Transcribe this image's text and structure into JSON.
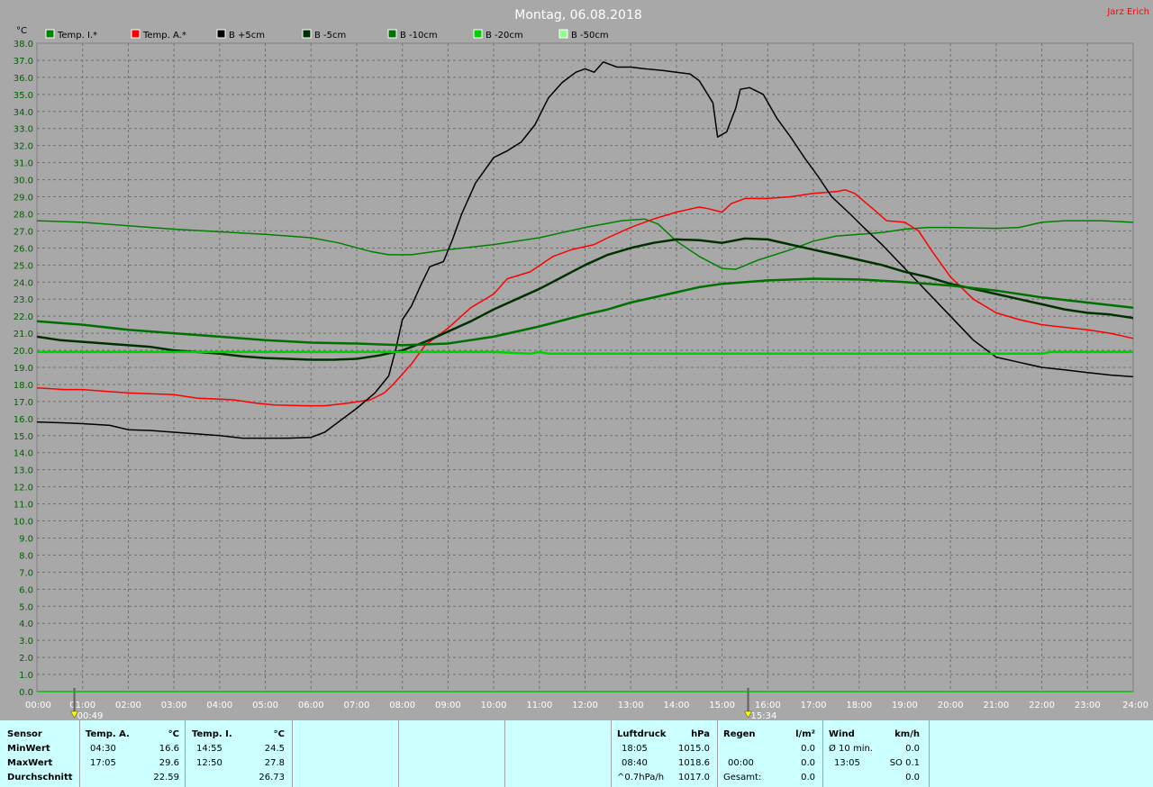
{
  "header": {
    "title": "Montag, 06.08.2018",
    "author": "Jarz Erich"
  },
  "chart_data": {
    "type": "line",
    "title": "Montag, 06.08.2018",
    "ylabel": "°C",
    "ylim": [
      0,
      38
    ],
    "xlim": [
      0,
      24
    ],
    "grid": true,
    "legend_position": "top",
    "x_tick_labels": [
      "00:00",
      "01:00",
      "02:00",
      "03:00",
      "04:00",
      "05:00",
      "06:00",
      "07:00",
      "08:00",
      "09:00",
      "10:00",
      "11:00",
      "12:00",
      "13:00",
      "14:00",
      "15:00",
      "16:00",
      "17:00",
      "18:00",
      "19:00",
      "20:00",
      "21:00",
      "22:00",
      "23:00",
      "24:00"
    ],
    "y_tick_labels": [
      "0.0",
      "1.0",
      "2.0",
      "3.0",
      "4.0",
      "5.0",
      "6.0",
      "7.0",
      "8.0",
      "9.0",
      "10.0",
      "11.0",
      "12.0",
      "13.0",
      "14.0",
      "15.0",
      "16.0",
      "17.0",
      "18.0",
      "19.0",
      "20.0",
      "21.0",
      "22.0",
      "23.0",
      "24.0",
      "25.0",
      "26.0",
      "27.0",
      "28.0",
      "29.0",
      "30.0",
      "31.0",
      "32.0",
      "33.0",
      "34.0",
      "35.0",
      "36.0",
      "37.0",
      "38.0"
    ],
    "series": [
      {
        "name": "Temp. I.*",
        "color": "#008000",
        "width": 1.5,
        "points": [
          [
            0,
            27.6
          ],
          [
            1,
            27.5
          ],
          [
            2,
            27.3
          ],
          [
            3,
            27.1
          ],
          [
            4,
            26.95
          ],
          [
            5,
            26.8
          ],
          [
            6,
            26.6
          ],
          [
            6.6,
            26.3
          ],
          [
            7.3,
            25.8
          ],
          [
            7.7,
            25.6
          ],
          [
            8.2,
            25.6
          ],
          [
            9,
            25.9
          ],
          [
            10,
            26.2
          ],
          [
            11,
            26.6
          ],
          [
            12,
            27.2
          ],
          [
            12.8,
            27.6
          ],
          [
            13.3,
            27.7
          ],
          [
            13.6,
            27.4
          ],
          [
            14,
            26.4
          ],
          [
            14.5,
            25.5
          ],
          [
            15,
            24.8
          ],
          [
            15.3,
            24.75
          ],
          [
            15.8,
            25.3
          ],
          [
            16.5,
            25.9
          ],
          [
            17,
            26.4
          ],
          [
            17.5,
            26.7
          ],
          [
            18,
            26.8
          ],
          [
            18.5,
            26.9
          ],
          [
            19,
            27.1
          ],
          [
            19.5,
            27.2
          ],
          [
            20,
            27.2
          ],
          [
            21,
            27.15
          ],
          [
            21.5,
            27.2
          ],
          [
            22,
            27.5
          ],
          [
            22.5,
            27.6
          ],
          [
            23.3,
            27.6
          ],
          [
            24,
            27.5
          ]
        ]
      },
      {
        "name": "Temp. A.*",
        "color": "#ff0000",
        "width": 1.5,
        "points": [
          [
            0,
            17.8
          ],
          [
            0.6,
            17.7
          ],
          [
            1,
            17.7
          ],
          [
            2,
            17.5
          ],
          [
            3,
            17.4
          ],
          [
            3.5,
            17.2
          ],
          [
            4.3,
            17.1
          ],
          [
            4.8,
            16.9
          ],
          [
            5.2,
            16.8
          ],
          [
            5.9,
            16.75
          ],
          [
            6.3,
            16.75
          ],
          [
            6.8,
            16.9
          ],
          [
            7.3,
            17.1
          ],
          [
            7.6,
            17.5
          ],
          [
            7.8,
            18.0
          ],
          [
            8.2,
            19.2
          ],
          [
            8.5,
            20.3
          ],
          [
            9,
            21.3
          ],
          [
            9.5,
            22.5
          ],
          [
            10,
            23.3
          ],
          [
            10.3,
            24.2
          ],
          [
            10.8,
            24.6
          ],
          [
            11.3,
            25.5
          ],
          [
            11.7,
            25.9
          ],
          [
            12.2,
            26.2
          ],
          [
            12.5,
            26.6
          ],
          [
            13,
            27.2
          ],
          [
            13.5,
            27.7
          ],
          [
            14,
            28.1
          ],
          [
            14.5,
            28.4
          ],
          [
            14.7,
            28.3
          ],
          [
            15,
            28.1
          ],
          [
            15.2,
            28.6
          ],
          [
            15.5,
            28.9
          ],
          [
            16,
            28.9
          ],
          [
            16.5,
            29.0
          ],
          [
            17,
            29.2
          ],
          [
            17.5,
            29.3
          ],
          [
            17.7,
            29.4
          ],
          [
            17.9,
            29.2
          ],
          [
            18.3,
            28.3
          ],
          [
            18.6,
            27.6
          ],
          [
            19,
            27.5
          ],
          [
            19.3,
            27.0
          ],
          [
            19.6,
            25.8
          ],
          [
            20,
            24.3
          ],
          [
            20.5,
            23.0
          ],
          [
            21,
            22.2
          ],
          [
            21.5,
            21.8
          ],
          [
            22,
            21.5
          ],
          [
            22.5,
            21.35
          ],
          [
            23,
            21.2
          ],
          [
            23.5,
            21.0
          ],
          [
            24,
            20.7
          ]
        ]
      },
      {
        "name": "B +5cm",
        "color": "#000000",
        "width": 1.5,
        "points": [
          [
            0,
            15.8
          ],
          [
            0.6,
            15.75
          ],
          [
            1,
            15.7
          ],
          [
            1.6,
            15.6
          ],
          [
            2,
            15.35
          ],
          [
            2.5,
            15.3
          ],
          [
            3,
            15.2
          ],
          [
            3.5,
            15.1
          ],
          [
            4,
            15.0
          ],
          [
            4.5,
            14.85
          ],
          [
            5,
            14.85
          ],
          [
            5.5,
            14.85
          ],
          [
            6,
            14.9
          ],
          [
            6.3,
            15.2
          ],
          [
            6.6,
            15.8
          ],
          [
            7,
            16.6
          ],
          [
            7.4,
            17.5
          ],
          [
            7.7,
            18.5
          ],
          [
            7.85,
            20.0
          ],
          [
            8,
            21.8
          ],
          [
            8.2,
            22.6
          ],
          [
            8.4,
            23.8
          ],
          [
            8.6,
            24.9
          ],
          [
            8.9,
            25.2
          ],
          [
            9.1,
            26.5
          ],
          [
            9.3,
            28.0
          ],
          [
            9.6,
            29.8
          ],
          [
            10,
            31.3
          ],
          [
            10.3,
            31.7
          ],
          [
            10.6,
            32.2
          ],
          [
            10.9,
            33.2
          ],
          [
            11.2,
            34.8
          ],
          [
            11.5,
            35.7
          ],
          [
            11.8,
            36.3
          ],
          [
            12,
            36.5
          ],
          [
            12.2,
            36.3
          ],
          [
            12.4,
            36.9
          ],
          [
            12.7,
            36.6
          ],
          [
            13,
            36.6
          ],
          [
            13.3,
            36.5
          ],
          [
            13.7,
            36.4
          ],
          [
            14,
            36.3
          ],
          [
            14.3,
            36.2
          ],
          [
            14.5,
            35.8
          ],
          [
            14.8,
            34.5
          ],
          [
            14.9,
            32.5
          ],
          [
            15.1,
            32.8
          ],
          [
            15.3,
            34.2
          ],
          [
            15.4,
            35.3
          ],
          [
            15.6,
            35.4
          ],
          [
            15.9,
            35.0
          ],
          [
            16.2,
            33.6
          ],
          [
            16.5,
            32.5
          ],
          [
            16.8,
            31.3
          ],
          [
            17.1,
            30.2
          ],
          [
            17.4,
            29.0
          ],
          [
            17.8,
            28.0
          ],
          [
            18.1,
            27.2
          ],
          [
            18.5,
            26.2
          ],
          [
            19,
            24.8
          ],
          [
            19.5,
            23.4
          ],
          [
            20,
            22.0
          ],
          [
            20.5,
            20.6
          ],
          [
            21,
            19.6
          ],
          [
            21.5,
            19.3
          ],
          [
            22,
            19.0
          ],
          [
            22.5,
            18.85
          ],
          [
            23,
            18.7
          ],
          [
            23.5,
            18.55
          ],
          [
            24,
            18.45
          ]
        ]
      },
      {
        "name": "B -5cm",
        "color": "#003000",
        "width": 2.5,
        "points": [
          [
            0,
            20.8
          ],
          [
            0.5,
            20.6
          ],
          [
            1,
            20.5
          ],
          [
            1.5,
            20.4
          ],
          [
            2,
            20.3
          ],
          [
            2.5,
            20.2
          ],
          [
            3,
            20.0
          ],
          [
            3.5,
            19.9
          ],
          [
            4,
            19.8
          ],
          [
            4.5,
            19.65
          ],
          [
            5,
            19.55
          ],
          [
            5.5,
            19.5
          ],
          [
            6,
            19.45
          ],
          [
            6.5,
            19.45
          ],
          [
            7,
            19.5
          ],
          [
            7.5,
            19.7
          ],
          [
            8,
            20.0
          ],
          [
            8.5,
            20.5
          ],
          [
            9,
            21.1
          ],
          [
            9.5,
            21.7
          ],
          [
            10,
            22.4
          ],
          [
            10.5,
            23.0
          ],
          [
            11,
            23.6
          ],
          [
            11.5,
            24.3
          ],
          [
            12,
            25.0
          ],
          [
            12.5,
            25.6
          ],
          [
            13,
            26.0
          ],
          [
            13.5,
            26.3
          ],
          [
            14,
            26.5
          ],
          [
            14.5,
            26.45
          ],
          [
            15,
            26.3
          ],
          [
            15.5,
            26.55
          ],
          [
            16,
            26.5
          ],
          [
            16.5,
            26.2
          ],
          [
            17,
            25.9
          ],
          [
            17.5,
            25.6
          ],
          [
            18,
            25.3
          ],
          [
            18.5,
            25.0
          ],
          [
            19,
            24.6
          ],
          [
            19.5,
            24.3
          ],
          [
            20,
            23.9
          ],
          [
            20.5,
            23.6
          ],
          [
            21,
            23.3
          ],
          [
            21.5,
            23.0
          ],
          [
            22,
            22.7
          ],
          [
            22.5,
            22.4
          ],
          [
            23,
            22.2
          ],
          [
            23.5,
            22.1
          ],
          [
            24,
            21.9
          ]
        ]
      },
      {
        "name": "B -10cm",
        "color": "#007000",
        "width": 2.5,
        "points": [
          [
            0,
            21.7
          ],
          [
            1,
            21.5
          ],
          [
            2,
            21.2
          ],
          [
            3,
            21.0
          ],
          [
            4,
            20.8
          ],
          [
            5,
            20.6
          ],
          [
            6,
            20.45
          ],
          [
            7,
            20.4
          ],
          [
            8,
            20.3
          ],
          [
            9,
            20.4
          ],
          [
            10,
            20.8
          ],
          [
            11,
            21.4
          ],
          [
            12,
            22.1
          ],
          [
            12.5,
            22.4
          ],
          [
            13,
            22.8
          ],
          [
            14,
            23.4
          ],
          [
            14.5,
            23.7
          ],
          [
            15,
            23.9
          ],
          [
            16,
            24.1
          ],
          [
            17,
            24.2
          ],
          [
            18,
            24.15
          ],
          [
            19,
            24.0
          ],
          [
            20,
            23.8
          ],
          [
            21,
            23.5
          ],
          [
            22,
            23.1
          ],
          [
            23,
            22.8
          ],
          [
            24,
            22.5
          ]
        ]
      },
      {
        "name": "B -20cm",
        "color": "#00d000",
        "width": 2.5,
        "points": [
          [
            0,
            19.9
          ],
          [
            5,
            19.9
          ],
          [
            10,
            19.9
          ],
          [
            10.8,
            19.8
          ],
          [
            11,
            19.9
          ],
          [
            11.2,
            19.8
          ],
          [
            15,
            19.8
          ],
          [
            20,
            19.8
          ],
          [
            22,
            19.8
          ],
          [
            22.2,
            19.9
          ],
          [
            24,
            19.9
          ]
        ]
      },
      {
        "name": "B -50cm",
        "color": "#90ff90",
        "width": 1.5,
        "points": []
      }
    ],
    "markers": [
      {
        "time": "00:49",
        "x": 0.82
      },
      {
        "time": "15:34",
        "x": 15.57
      }
    ]
  },
  "stats": {
    "temp_a": {
      "sensor_label": "Sensor",
      "header": "Temp. A.",
      "unit": "°C",
      "rows": [
        {
          "label": "MinWert",
          "time": "04:30",
          "value": "16.6"
        },
        {
          "label": "MaxWert",
          "time": "17:05",
          "value": "29.6"
        },
        {
          "label": "Durchschnitt",
          "time": "",
          "value": "22.59"
        }
      ]
    },
    "temp_i": {
      "header": "Temp. I.",
      "unit": "°C",
      "rows": [
        {
          "time": "14:55",
          "value": "24.5"
        },
        {
          "time": "12:50",
          "value": "27.8"
        },
        {
          "time": "",
          "value": "26.73"
        }
      ]
    },
    "luftdruck": {
      "header": "Luftdruck",
      "unit": "hPa",
      "rows": [
        {
          "time": "18:05",
          "value": "1015.0"
        },
        {
          "time": "08:40",
          "value": "1018.6"
        },
        {
          "time": "^0.7hPa/h",
          "value": "1017.0"
        }
      ]
    },
    "regen": {
      "header": "Regen",
      "unit": "l/m²",
      "rows": [
        {
          "time": "",
          "value": "0.0"
        },
        {
          "time": "00:00",
          "value": "0.0"
        },
        {
          "time": "Gesamt:",
          "value": "0.0"
        }
      ]
    },
    "wind": {
      "header": "Wind",
      "unit": "km/h",
      "rows": [
        {
          "time": "Ø 10 min.",
          "value": "0.0"
        },
        {
          "time": "13:05",
          "value": "SO 0.1"
        },
        {
          "time": "",
          "value": "0.0"
        }
      ]
    }
  }
}
